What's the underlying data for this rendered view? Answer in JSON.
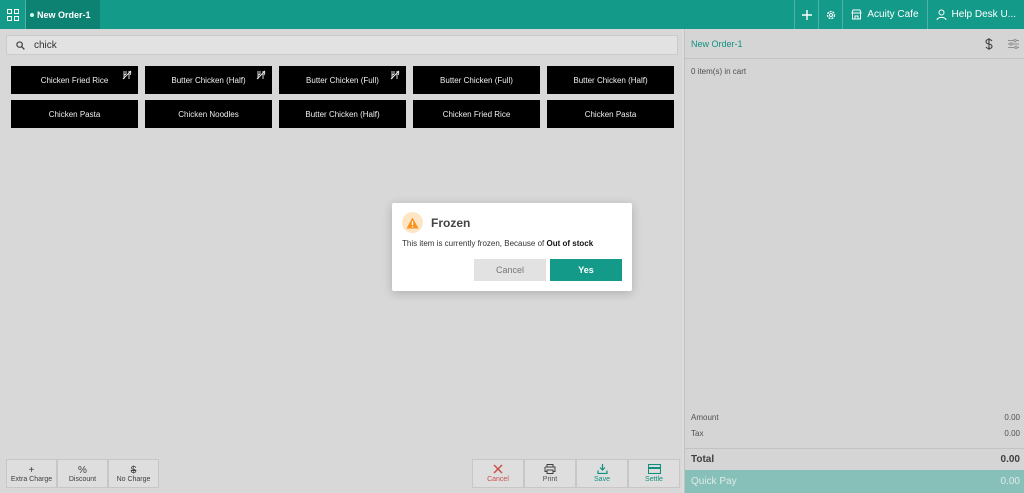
{
  "topbar": {
    "tab_label": "New Order-1",
    "store_label": "Acuity Cafe",
    "user_label": "Help Desk U...",
    "icons": [
      "apps-grid-icon",
      "plus-icon",
      "gear-icon",
      "store-icon",
      "user-icon"
    ]
  },
  "search": {
    "value": "chick"
  },
  "items": [
    {
      "label": "Chicken Fried Rice",
      "frozen": true
    },
    {
      "label": "Butter Chicken (Half)",
      "frozen": true
    },
    {
      "label": "Butter Chicken (Full)",
      "frozen": true
    },
    {
      "label": "Butter Chicken (Full)",
      "frozen": false
    },
    {
      "label": "Butter Chicken (Half)",
      "frozen": false
    },
    {
      "label": "Chicken Pasta",
      "frozen": false
    },
    {
      "label": "Chicken Noodles",
      "frozen": false
    },
    {
      "label": "Butter Chicken (Half)",
      "frozen": false
    },
    {
      "label": "Chicken Fried Rice",
      "frozen": false
    },
    {
      "label": "Chicken Pasta",
      "frozen": false
    }
  ],
  "actions_left": [
    {
      "symbol": "+",
      "label": "Extra Charge"
    },
    {
      "symbol": "%",
      "label": "Discount"
    },
    {
      "symbol": "$",
      "label": "No Charge"
    }
  ],
  "actions_right": [
    {
      "label": "Cancel",
      "color": "#d9534f",
      "icon": "close-icon"
    },
    {
      "label": "Print",
      "color": "#555555",
      "icon": "printer-icon"
    },
    {
      "label": "Save",
      "color": "#139a89",
      "icon": "download-icon"
    },
    {
      "label": "Settle",
      "color": "#139a89",
      "icon": "card-icon"
    }
  ],
  "cart": {
    "title": "New Order-1",
    "count_text": "0 item(s) in cart",
    "amount_label": "Amount",
    "amount_value": "0.00",
    "tax_label": "Tax",
    "tax_value": "0.00",
    "total_label": "Total",
    "total_value": "0.00",
    "quickpay_label": "Quick Pay",
    "quickpay_value": "0.00"
  },
  "dialog": {
    "title": "Frozen",
    "message": "This item is currently frozen, Because of ",
    "reason": "Out of stock",
    "cancel_label": "Cancel",
    "yes_label": "Yes"
  },
  "colors": {
    "brand": "#139a89",
    "warning": "#f7941d",
    "danger": "#d9534f"
  }
}
